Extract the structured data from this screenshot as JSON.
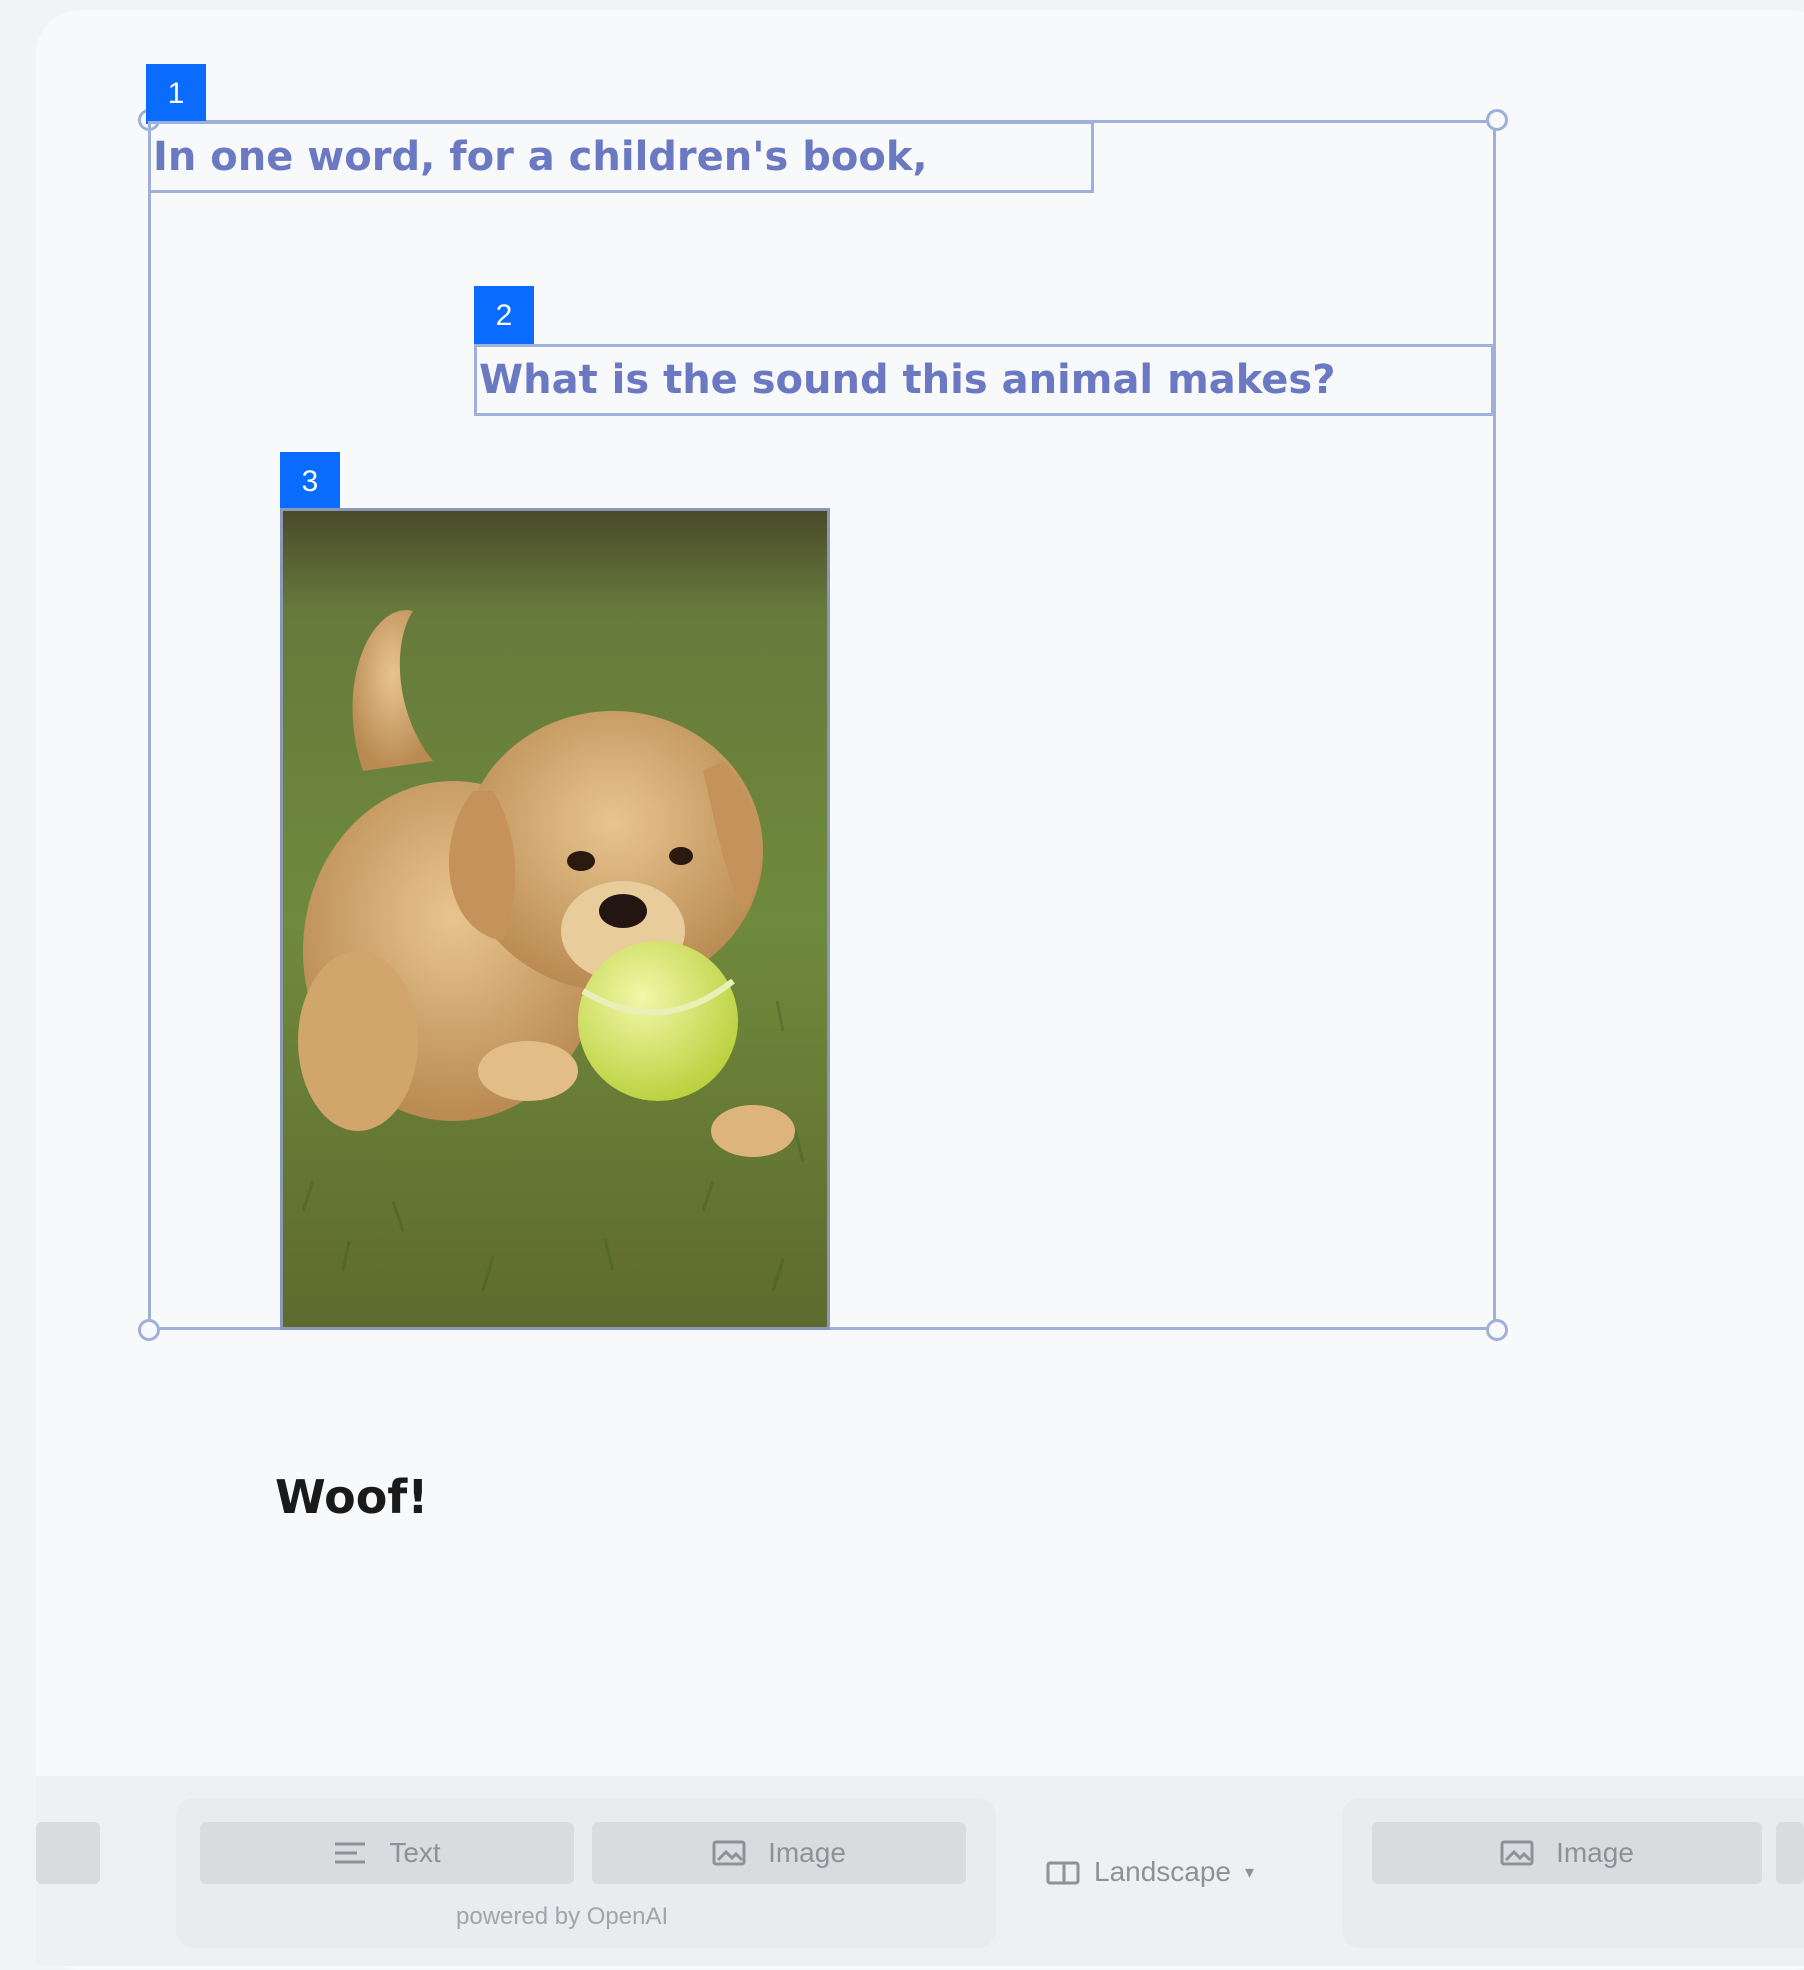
{
  "canvas": {
    "elements": [
      {
        "tag": "1",
        "text": "In one word, for a children's book,"
      },
      {
        "tag": "2",
        "text": "What is the sound this animal makes?"
      },
      {
        "tag": "3",
        "image": "puppy with tennis ball on grass"
      }
    ],
    "answer": "Woof!"
  },
  "toolbar": {
    "text_label": "Text",
    "image_label": "Image",
    "powered_by": "powered by OpenAI",
    "orientation": "Landscape",
    "image_label_2": "Image"
  },
  "colors": {
    "tag": "#0a6cff",
    "selection": "#9fb1da",
    "prompt_text": "#6b78c2"
  },
  "icons": [
    "text-icon",
    "image-icon",
    "landscape-icon",
    "chevron-down-icon"
  ]
}
